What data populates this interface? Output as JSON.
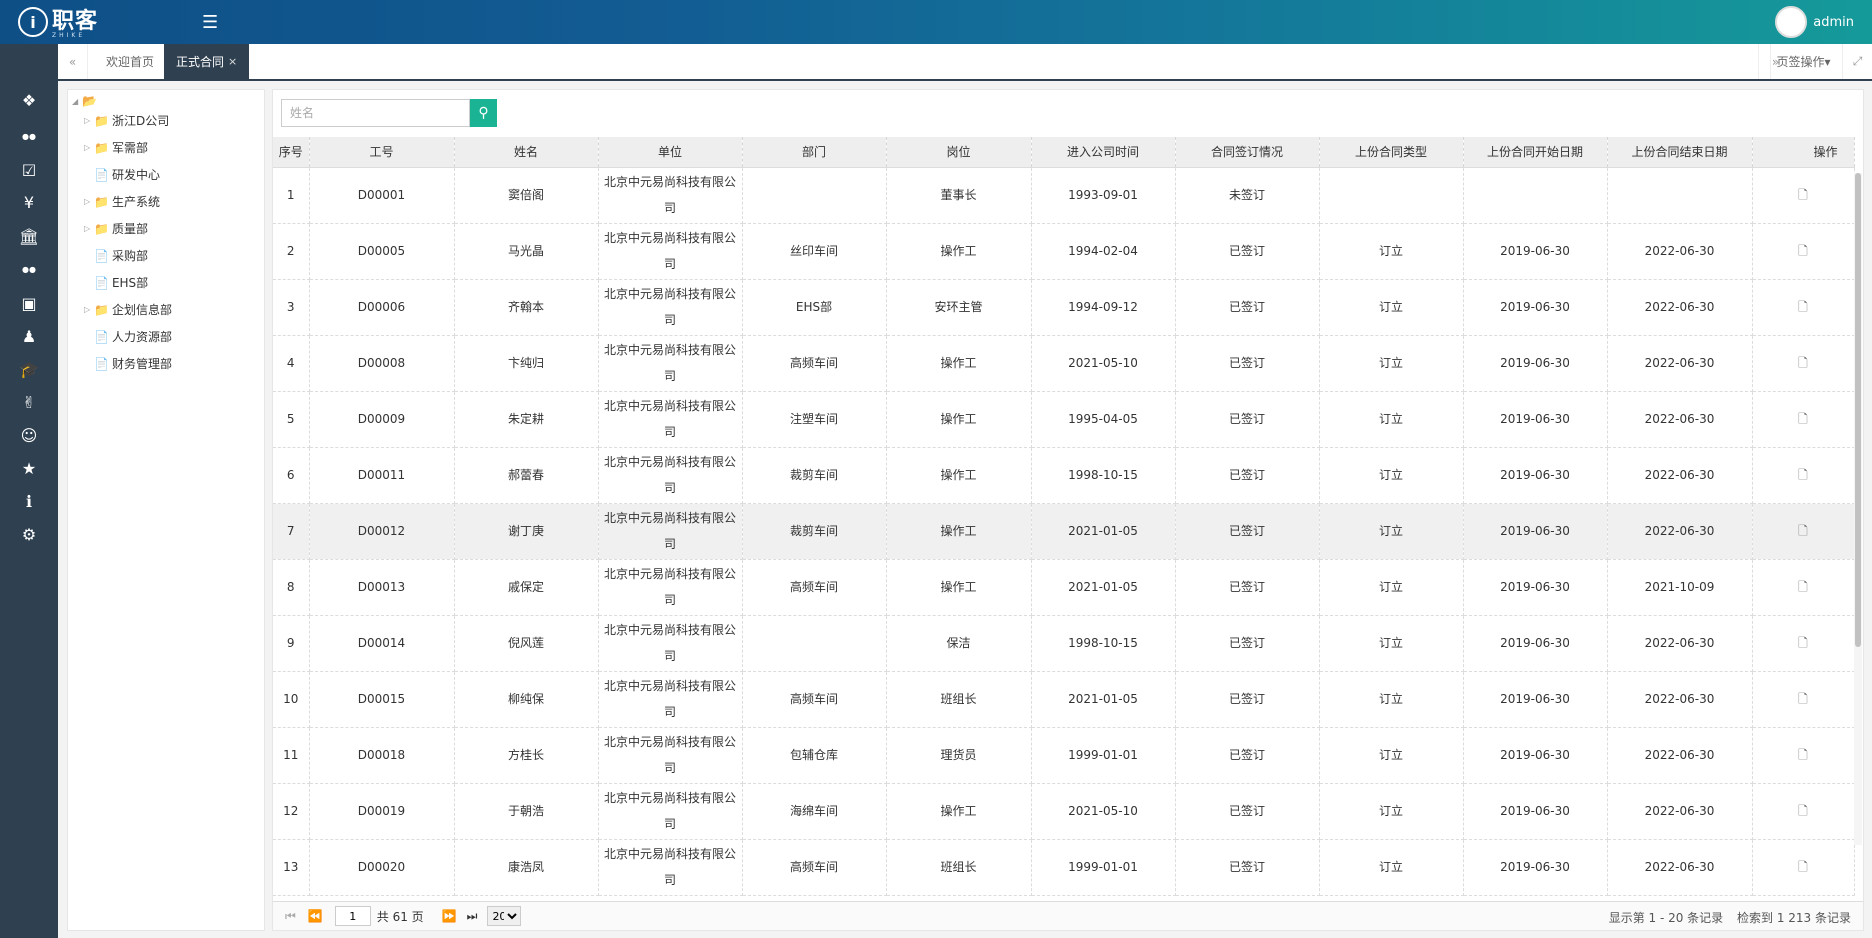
{
  "header": {
    "logo_text": "职客",
    "logo_sub": "ZHIKE",
    "username": "admin"
  },
  "sidebar_icons": [
    "cubes-icon",
    "users-icon",
    "check-square-icon",
    "yen-icon",
    "bank-icon",
    "group-icon",
    "briefcase-icon",
    "user-tie-icon",
    "graduation-cap-icon",
    "hand-icon",
    "user-icon",
    "trophy-icon",
    "info-icon",
    "gears-icon"
  ],
  "tabs": {
    "items": [
      {
        "label": "欢迎首页"
      },
      {
        "label": "正式合同",
        "active": true,
        "close": "×"
      }
    ],
    "page_ops": "页签操作"
  },
  "tree": {
    "nodes": [
      {
        "label": "浙江D公司",
        "folder": true,
        "level": 1
      },
      {
        "label": "军需部",
        "folder": true,
        "level": 1
      },
      {
        "label": "研发中心",
        "folder": false,
        "level": 1
      },
      {
        "label": "生产系统",
        "folder": true,
        "level": 1
      },
      {
        "label": "质量部",
        "folder": true,
        "level": 1
      },
      {
        "label": "采购部",
        "folder": false,
        "level": 1
      },
      {
        "label": "EHS部",
        "folder": false,
        "level": 1
      },
      {
        "label": "企划信息部",
        "folder": true,
        "level": 1
      },
      {
        "label": "人力资源部",
        "folder": false,
        "level": 1
      },
      {
        "label": "财务管理部",
        "folder": false,
        "level": 1
      }
    ]
  },
  "search": {
    "placeholder": "姓名"
  },
  "table": {
    "columns": [
      "序号",
      "工号",
      "姓名",
      "单位",
      "部门",
      "岗位",
      "进入公司时间",
      "合同签订情况",
      "上份合同类型",
      "上份合同开始日期",
      "上份合同结束日期",
      "操作"
    ],
    "rows": [
      [
        "1",
        "D00001",
        "窦倍阁",
        "北京中元易尚科技有限公司",
        "",
        "董事长",
        "1993-09-01",
        "未签订",
        "",
        "",
        ""
      ],
      [
        "2",
        "D00005",
        "马光晶",
        "北京中元易尚科技有限公司",
        "丝印车间",
        "操作工",
        "1994-02-04",
        "已签订",
        "订立",
        "2019-06-30",
        "2022-06-30"
      ],
      [
        "3",
        "D00006",
        "齐翰本",
        "北京中元易尚科技有限公司",
        "EHS部",
        "安环主管",
        "1994-09-12",
        "已签订",
        "订立",
        "2019-06-30",
        "2022-06-30"
      ],
      [
        "4",
        "D00008",
        "卞纯归",
        "北京中元易尚科技有限公司",
        "高频车间",
        "操作工",
        "2021-05-10",
        "已签订",
        "订立",
        "2019-06-30",
        "2022-06-30"
      ],
      [
        "5",
        "D00009",
        "朱定耕",
        "北京中元易尚科技有限公司",
        "注塑车间",
        "操作工",
        "1995-04-05",
        "已签订",
        "订立",
        "2019-06-30",
        "2022-06-30"
      ],
      [
        "6",
        "D00011",
        "郝蕾春",
        "北京中元易尚科技有限公司",
        "裁剪车间",
        "操作工",
        "1998-10-15",
        "已签订",
        "订立",
        "2019-06-30",
        "2022-06-30"
      ],
      [
        "7",
        "D00012",
        "谢丁庚",
        "北京中元易尚科技有限公司",
        "裁剪车间",
        "操作工",
        "2021-01-05",
        "已签订",
        "订立",
        "2019-06-30",
        "2022-06-30"
      ],
      [
        "8",
        "D00013",
        "戚保定",
        "北京中元易尚科技有限公司",
        "高频车间",
        "操作工",
        "2021-01-05",
        "已签订",
        "订立",
        "2019-06-30",
        "2021-10-09"
      ],
      [
        "9",
        "D00014",
        "倪风莲",
        "北京中元易尚科技有限公司",
        "",
        "保洁",
        "1998-10-15",
        "已签订",
        "订立",
        "2019-06-30",
        "2022-06-30"
      ],
      [
        "10",
        "D00015",
        "柳纯保",
        "北京中元易尚科技有限公司",
        "高频车间",
        "班组长",
        "2021-01-05",
        "已签订",
        "订立",
        "2019-06-30",
        "2022-06-30"
      ],
      [
        "11",
        "D00018",
        "方桂长",
        "北京中元易尚科技有限公司",
        "包辅仓库",
        "理货员",
        "1999-01-01",
        "已签订",
        "订立",
        "2019-06-30",
        "2022-06-30"
      ],
      [
        "12",
        "D00019",
        "于朝浩",
        "北京中元易尚科技有限公司",
        "海绵车间",
        "操作工",
        "2021-05-10",
        "已签订",
        "订立",
        "2019-06-30",
        "2022-06-30"
      ],
      [
        "13",
        "D00020",
        "康浩凤",
        "北京中元易尚科技有限公司",
        "高频车间",
        "班组长",
        "1999-01-01",
        "已签订",
        "订立",
        "2019-06-30",
        "2022-06-30"
      ]
    ],
    "highlight_row": 6
  },
  "pager": {
    "current_page": "1",
    "total_pages": "共 61 页",
    "page_size": "20",
    "range_info": "显示第 1 - 20 条记录",
    "total_info": "检索到 1 213 条记录"
  }
}
